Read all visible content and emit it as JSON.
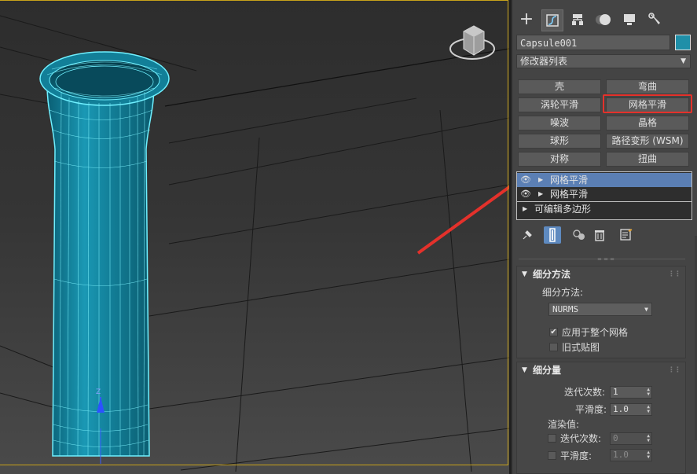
{
  "viewport": {
    "axis_label": "Z"
  },
  "panel": {
    "tabs": [
      {
        "icon": "plus-icon",
        "name": "create"
      },
      {
        "icon": "modify-icon",
        "name": "modify"
      },
      {
        "icon": "hierarchy-icon",
        "name": "hierarchy"
      },
      {
        "icon": "motion-icon",
        "name": "motion"
      },
      {
        "icon": "display-icon",
        "name": "display"
      },
      {
        "icon": "wrench-icon",
        "name": "utilities"
      }
    ],
    "object_name": "Capsule001",
    "object_color": "#1f8fa8",
    "modifier_list_label": "修改器列表",
    "modifier_buttons": [
      "壳",
      "弯曲",
      "涡轮平滑",
      "网格平滑",
      "噪波",
      "晶格",
      "球形",
      "路径变形 (WSM)",
      "对称",
      "扭曲"
    ],
    "highlight_color": "#e4312b",
    "stack": [
      {
        "label": "网格平滑",
        "selected": true,
        "eye": true
      },
      {
        "label": "网格平滑",
        "selected": false,
        "eye": true
      },
      {
        "label": "可编辑多边形",
        "selected": false,
        "eye": false
      }
    ]
  },
  "subdivision_method": {
    "title": "细分方法",
    "method_label": "细分方法:",
    "method_value": "NURMS",
    "apply_whole_mesh": {
      "label": "应用于整个网格",
      "checked": true
    },
    "old_style_mapping": {
      "label": "旧式贴图",
      "checked": false
    }
  },
  "subdivision_amount": {
    "title": "细分量",
    "iterations_label": "迭代次数:",
    "iterations_value": "1",
    "smoothness_label": "平滑度:",
    "smoothness_value": "1.0",
    "render_values_label": "渲染值:",
    "render_iterations_label": "迭代次数:",
    "render_iterations_value": "0",
    "render_smoothness_label": "平滑度:",
    "render_smoothness_value": "1.0"
  }
}
